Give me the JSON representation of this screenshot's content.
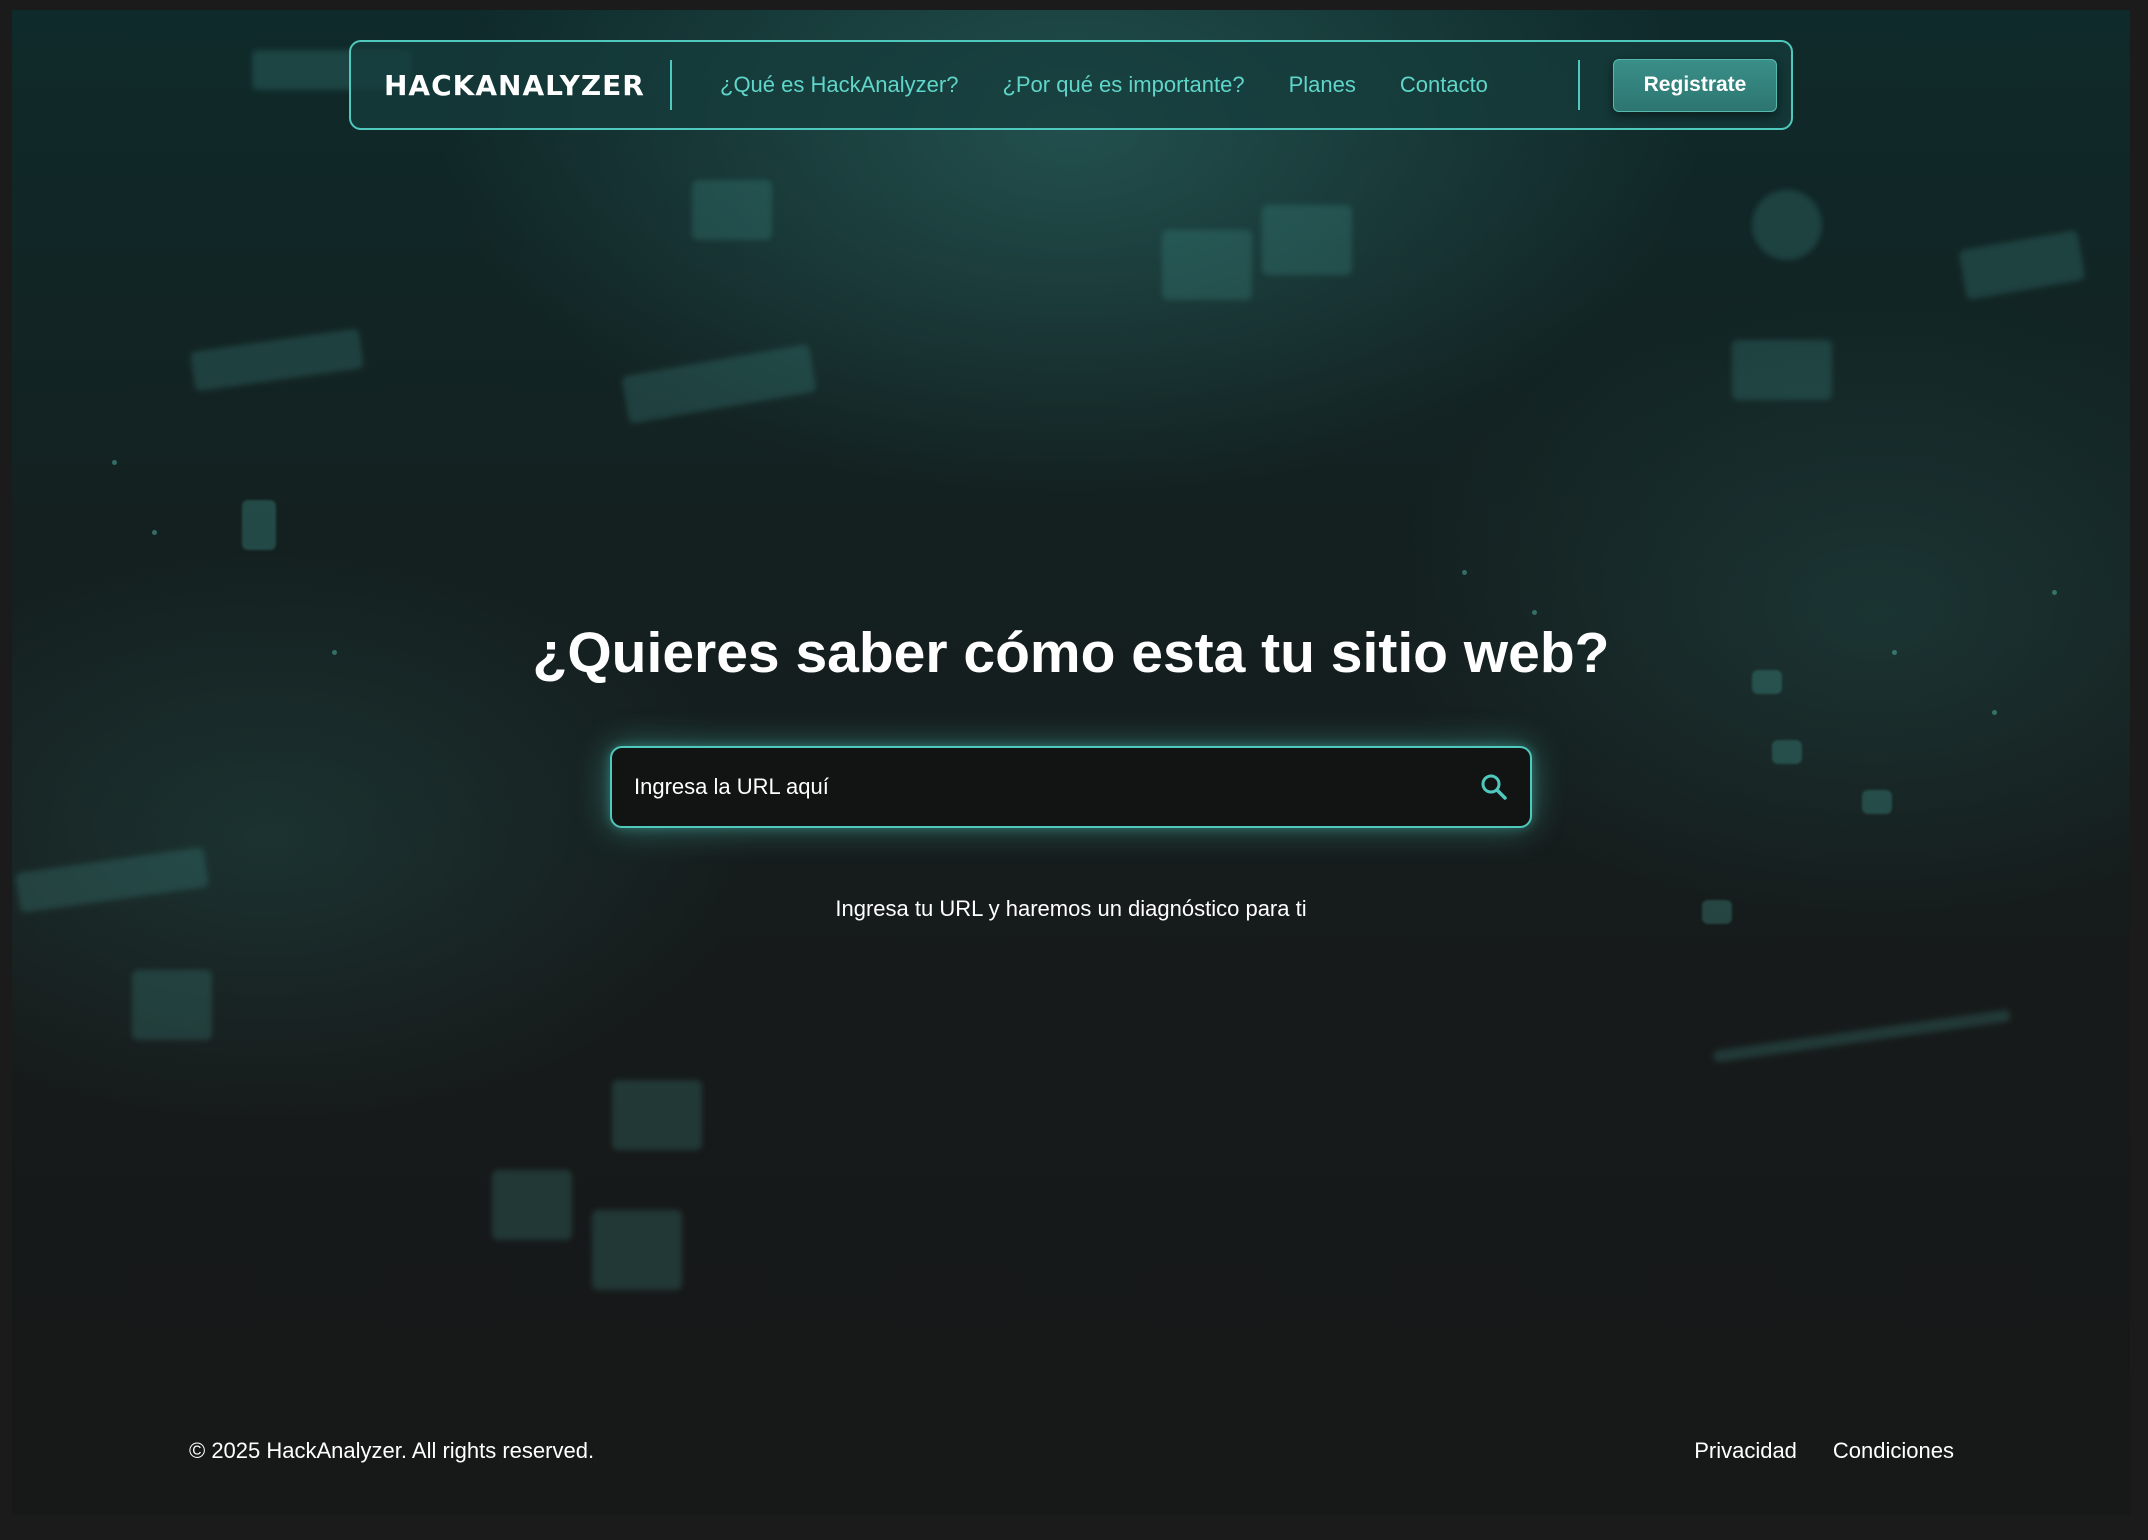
{
  "brand": {
    "logo": "HACKANALYZER"
  },
  "nav": {
    "links": [
      {
        "label": "¿Qué es HackAnalyzer?"
      },
      {
        "label": "¿Por qué es importante?"
      },
      {
        "label": "Planes"
      },
      {
        "label": "Contacto"
      }
    ],
    "register_label": "Registrate"
  },
  "hero": {
    "title": "¿Quieres saber cómo esta tu sitio web?",
    "search_placeholder": "Ingresa la URL aquí",
    "hint": "Ingresa tu URL y haremos un diagnóstico para ti"
  },
  "footer": {
    "copyright": "© 2025 HackAnalyzer. All rights reserved.",
    "links": [
      {
        "label": "Privacidad"
      },
      {
        "label": "Condiciones"
      }
    ]
  },
  "colors": {
    "accent": "#4fc9bd",
    "nav_text": "#5fd6c9",
    "button_bg": "#2d7570",
    "background": "#161a1a"
  },
  "icons": {
    "search": "search-icon"
  }
}
